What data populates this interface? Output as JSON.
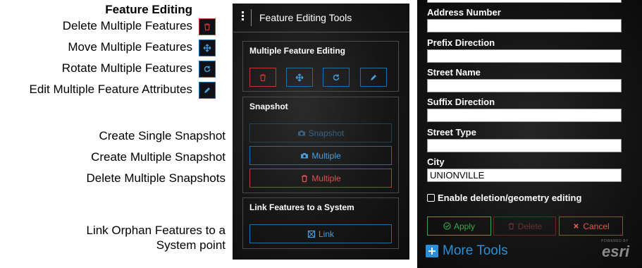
{
  "legend": {
    "title": "Feature Editing",
    "rows": [
      "Delete Multiple Features",
      "Move Multiple Features",
      "Rotate Multiple Features",
      "Edit Multiple Feature Attributes",
      "Create Single Snapshot",
      "Create Multiple Snapshot",
      "Delete Multiple Snapshots",
      "Link Orphan Features to a",
      "System point"
    ],
    "icons": [
      "trash-icon",
      "move-icon",
      "rotate-icon",
      "pencil-icon"
    ]
  },
  "panel": {
    "title": "Feature Editing Tools",
    "sections": {
      "multiple": {
        "title": "Multiple Feature Editing"
      },
      "snapshot": {
        "title": "Snapshot",
        "buttons": {
          "single": "Snapshot",
          "multiple": "Multiple",
          "delete": "Multiple"
        }
      },
      "link": {
        "title": "Link Features to a System",
        "button": "Link"
      }
    }
  },
  "form": {
    "fields": [
      {
        "label": "Address Number",
        "value": ""
      },
      {
        "label": "Prefix Direction",
        "value": ""
      },
      {
        "label": "Street Name",
        "value": ""
      },
      {
        "label": "Suffix Direction",
        "value": ""
      },
      {
        "label": "Street Type",
        "value": ""
      },
      {
        "label": "City",
        "value": "UNIONVILLE"
      }
    ],
    "checkbox_label": "Enable deletion/geometry editing",
    "buttons": {
      "apply": "Apply",
      "delete": "Delete",
      "cancel": "Cancel"
    },
    "more_tools": "More Tools",
    "powered_by": "POWERED BY",
    "logo": "esri"
  },
  "colors": {
    "accent_blue": "#1c6ea4",
    "link_blue": "#2a8fd6",
    "danger_red": "#c0392b",
    "success_green": "#3aa54a"
  }
}
